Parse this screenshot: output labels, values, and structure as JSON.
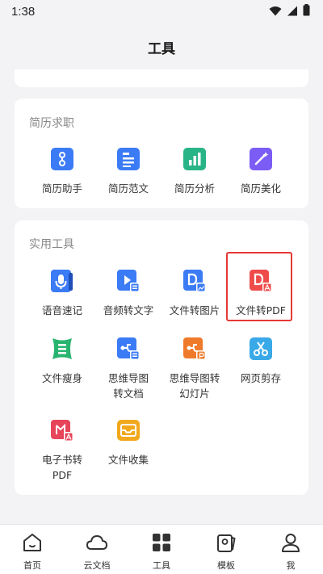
{
  "status": {
    "time": "1:38"
  },
  "header": {
    "title": "工具"
  },
  "resume_section": {
    "title": "简历求职",
    "items": [
      {
        "label": "简历助手",
        "icon": "resume-assistant-icon",
        "color": "#3b7bf5"
      },
      {
        "label": "简历范文",
        "icon": "resume-sample-icon",
        "color": "#3b7bf5"
      },
      {
        "label": "简历分析",
        "icon": "resume-analysis-icon",
        "color": "#28b487"
      },
      {
        "label": "简历美化",
        "icon": "resume-beautify-icon",
        "color": "#7b5cf5"
      }
    ]
  },
  "tools_section": {
    "title": "实用工具",
    "items": [
      {
        "label": "语音速记",
        "icon": "voice-note-icon",
        "color": "#3b7bf5"
      },
      {
        "label": "音频转文字",
        "icon": "audio-to-text-icon",
        "color": "#3b7bf5"
      },
      {
        "label": "文件转图片",
        "icon": "file-to-image-icon",
        "color": "#3b7bf5"
      },
      {
        "label": "文件转PDF",
        "icon": "file-to-pdf-icon",
        "color": "#ef4b4b"
      },
      {
        "label": "文件瘦身",
        "icon": "file-compress-icon",
        "color": "#28b470"
      },
      {
        "label": "思维导图转文档",
        "icon": "mindmap-to-doc-icon",
        "color": "#3b7bf5"
      },
      {
        "label": "思维导图转幻灯片",
        "icon": "mindmap-to-slides-icon",
        "color": "#f07a2b"
      },
      {
        "label": "网页剪存",
        "icon": "web-clip-icon",
        "color": "#3aa9e8"
      },
      {
        "label": "电子书转PDF",
        "icon": "ebook-to-pdf-icon",
        "color": "#e6455a"
      },
      {
        "label": "文件收集",
        "icon": "file-collect-icon",
        "color": "#f2a81d"
      }
    ]
  },
  "tabbar": {
    "tabs": [
      {
        "label": "首页",
        "icon": "home-icon"
      },
      {
        "label": "云文档",
        "icon": "cloud-icon"
      },
      {
        "label": "工具",
        "icon": "tools-grid-icon"
      },
      {
        "label": "模板",
        "icon": "template-icon"
      },
      {
        "label": "我",
        "icon": "profile-icon"
      }
    ]
  }
}
